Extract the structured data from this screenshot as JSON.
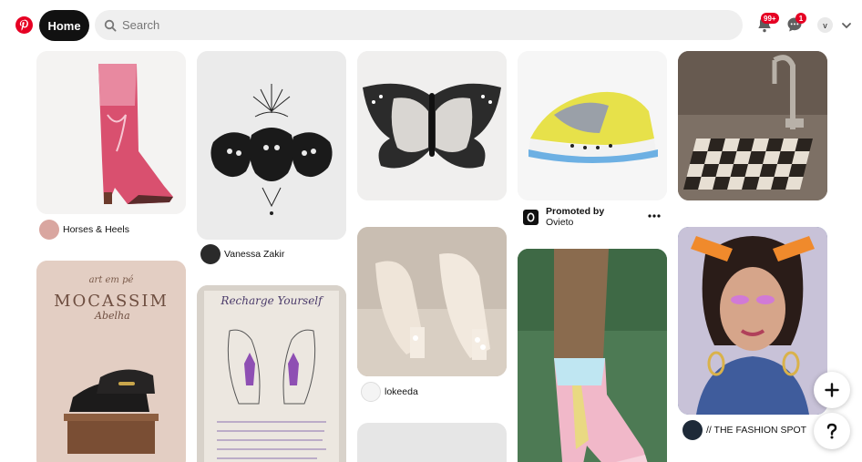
{
  "header": {
    "home_label": "Home",
    "search_placeholder": "Search",
    "notifications_badge": "99+",
    "messages_badge": "1",
    "profile_initial": "v"
  },
  "pins": {
    "pin1_creator": "Horses & Heels",
    "pin2_creator": "Vanessa Zakir",
    "pin3_creator": "lokeeda",
    "pin4_promoted": "Promoted by",
    "pin4_advertiser": "Ovieto",
    "pin5_creator": "// THE FASHION SPOT",
    "mocassim_heading": "art em pé",
    "mocassim_title": "MOCASSIM",
    "mocassim_subtitle": "Abelha",
    "recharge_title": "Recharge Yourself"
  },
  "colors": {
    "brand": "#e60023",
    "home_bg": "#111111",
    "search_bg": "#efefef"
  },
  "icons": [
    "pinterest-logo-icon",
    "search-icon",
    "bell-icon",
    "message-icon",
    "chevron-down-icon",
    "more-icon",
    "plus-icon",
    "help-icon"
  ]
}
